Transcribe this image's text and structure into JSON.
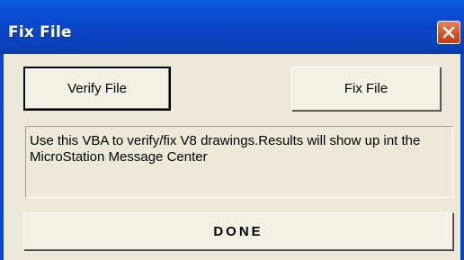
{
  "window": {
    "title": "Fix File"
  },
  "buttons": {
    "verify_label": "Verify File",
    "fix_label": "Fix File",
    "done_label": "DONE"
  },
  "message": {
    "text": "Use this VBA to verify/fix V8 drawings.Results will show up int the MicroStation Message Center"
  },
  "colors": {
    "titlebar": "#0a47c8",
    "client_background": "#ece9d8",
    "close_button": "#d5522a"
  },
  "icons": {
    "close": "close-icon"
  }
}
